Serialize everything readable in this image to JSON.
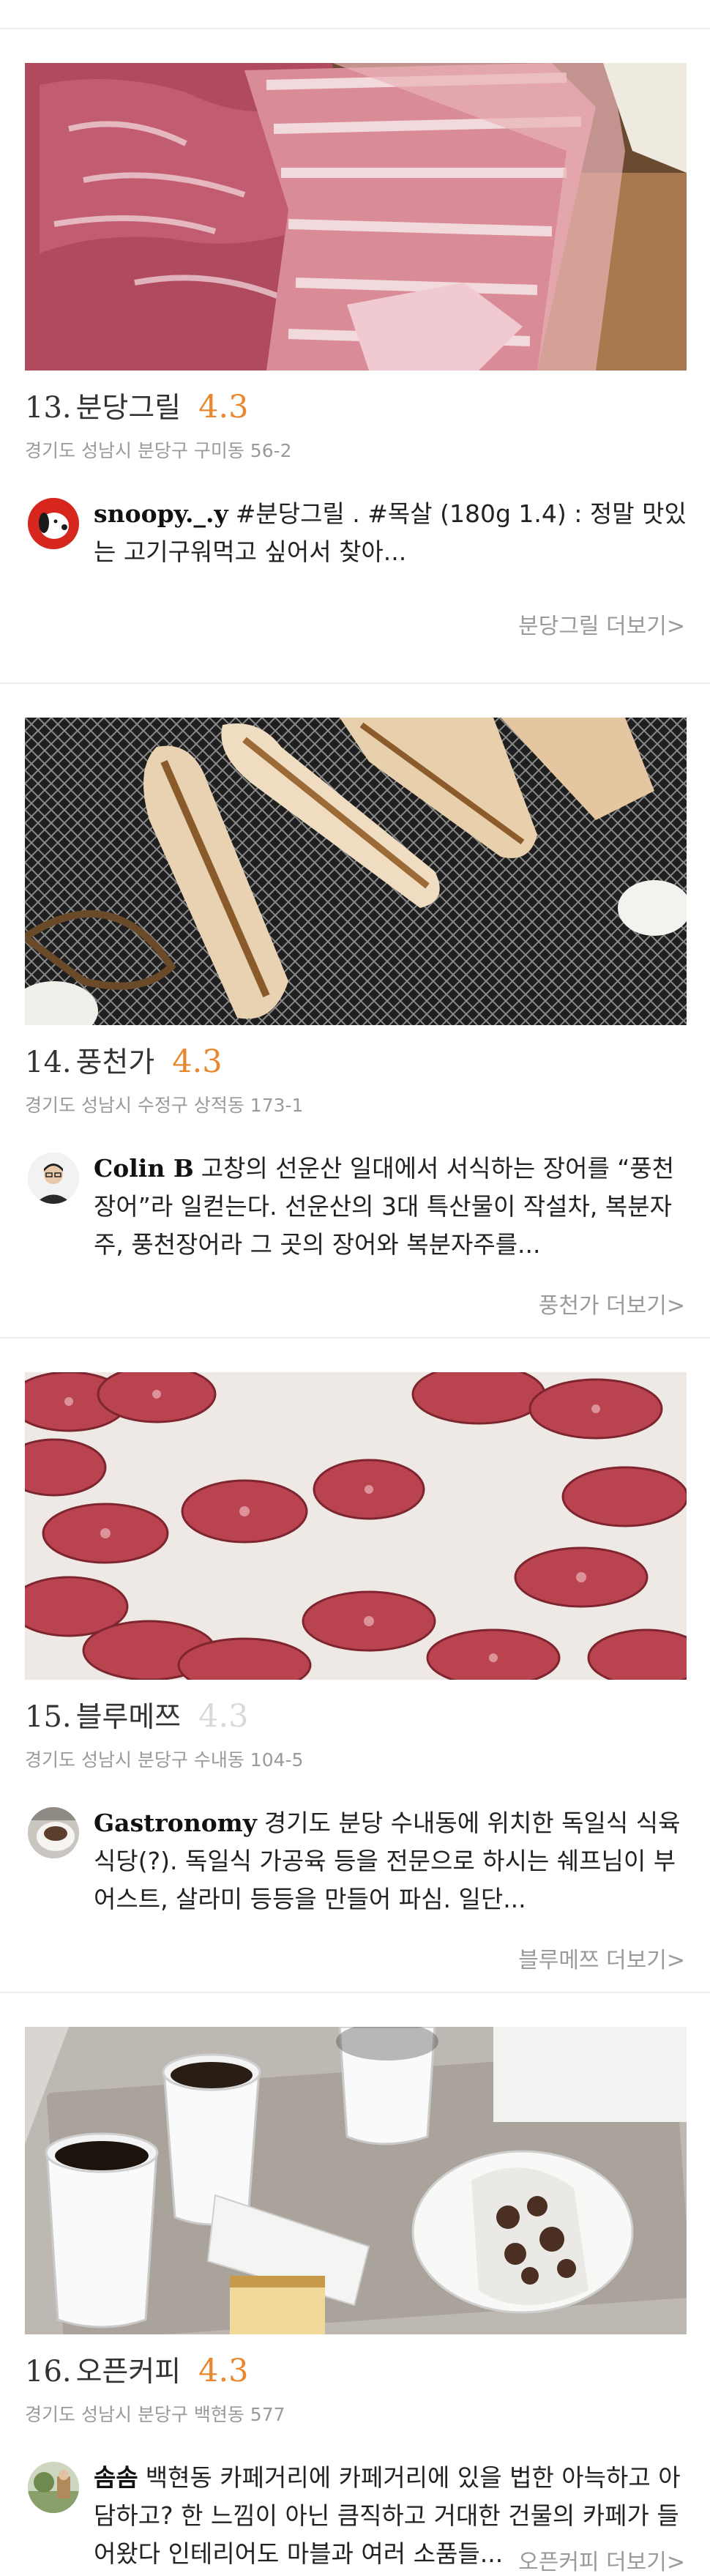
{
  "items": [
    {
      "rank": "13.",
      "name": "분당그릴",
      "score": "4.3",
      "address": "경기도 성남시 분당구 구미동 56-2",
      "reviewer": "snoopy._.y",
      "review": "#분당그릴 . #목살 (180g 1.4) : 정말 맛있는 고기구워먹고 싶어서 찾아...",
      "more": "분당그릴 더보기>"
    },
    {
      "rank": "14.",
      "name": "풍천가",
      "score": "4.3",
      "address": "경기도 성남시 수정구 상적동 173-1",
      "reviewer": "Colin B",
      "review": "고창의 선운산 일대에서 서식하는 장어를 “풍천장어”라 일컫는다. 선운산의 3대 특산물이 작설차, 복분자주, 풍천장어라 그 곳의 장어와 복분자주를...",
      "more": "풍천가 더보기>"
    },
    {
      "rank": "15.",
      "name": "블루메쯔",
      "score": "4.3",
      "address": "경기도 성남시 분당구 수내동 104-5",
      "reviewer": "Gastronomy",
      "review": "경기도 분당 수내동에 위치한 독일식 식육식당(?). 독일식 가공육 등을 전문으로 하시는 쉐프님이 부어스트, 살라미 등등을 만들어 파심. 일단...",
      "more": "블루메쯔 더보기>"
    },
    {
      "rank": "16.",
      "name": "오픈커피",
      "score": "4.3",
      "address": "경기도 성남시 분당구 백현동 577",
      "reviewer": "솜솜",
      "review": "백현동 카페거리에 카페거리에 있을 법한 아늑하고 아담하고? 한 느낌이 아닌 큼직하고 거대한 건물의 카페가 들어왔다 인테리어도 마블과 여러 소품들...",
      "more": "오픈커피 더보기>"
    }
  ],
  "colors": {
    "score": "#e8872d",
    "score_dim": "#d9d9d9",
    "muted": "#9a9a9a",
    "divider": "#ececec"
  },
  "icons": [
    "pork-photo",
    "eel-photo",
    "salami-photo",
    "coffee-photo",
    "snoopy-avatar",
    "man-avatar",
    "coffee-cup-avatar",
    "park-avatar"
  ]
}
